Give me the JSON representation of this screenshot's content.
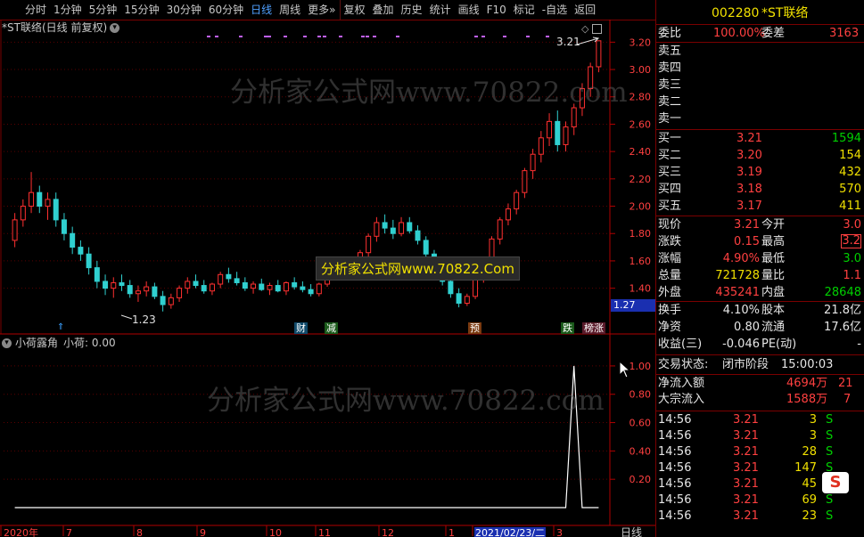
{
  "toolbar": {
    "items": [
      "分时",
      "1分钟",
      "5分钟",
      "15分钟",
      "30分钟",
      "60分钟",
      "日线",
      "周线",
      "更多»",
      "复权",
      "叠加",
      "历史",
      "统计",
      "画线",
      "F10",
      "标记",
      "-自选",
      "返回"
    ],
    "selected": "日线"
  },
  "kchart": {
    "title": "*ST联络(日线 前复权)",
    "high_label": "3.21",
    "low_label": "1.23",
    "current_price_tag": "1.27",
    "y_ticks": [
      "3.20",
      "3.00",
      "2.80",
      "2.60",
      "2.40",
      "2.20",
      "2.00",
      "1.80",
      "1.60",
      "1.40"
    ],
    "markers": [
      "财",
      "减",
      "预",
      "跌",
      "榜涨"
    ],
    "watermark": "分析家公式网www.70822.com",
    "banner": "分析家公式网www.70822.Com"
  },
  "indicator": {
    "name": "小荷露角",
    "value_label": "小荷: 0.00",
    "y_ticks": [
      "1.00",
      "0.80",
      "0.60",
      "0.40",
      "0.20"
    ],
    "watermark": "分析家公式网www.70822.com"
  },
  "timeaxis": {
    "labels": [
      "2020年",
      "7",
      "8",
      "9",
      "10",
      "11",
      "12",
      "1",
      "2021/02/23/二",
      "3"
    ],
    "period": "日线"
  },
  "chart_data": {
    "type": "candlestick",
    "ylim": [
      1.15,
      3.3
    ],
    "candles": [
      [
        1.75,
        1.95,
        1.7,
        1.9
      ],
      [
        1.9,
        2.05,
        1.85,
        2.0
      ],
      [
        2.0,
        2.25,
        1.95,
        2.1
      ],
      [
        2.1,
        2.15,
        1.95,
        2.0
      ],
      [
        2.0,
        2.1,
        1.9,
        2.05
      ],
      [
        2.05,
        2.1,
        1.85,
        1.9
      ],
      [
        1.9,
        1.95,
        1.75,
        1.8
      ],
      [
        1.8,
        1.85,
        1.65,
        1.7
      ],
      [
        1.7,
        1.75,
        1.6,
        1.65
      ],
      [
        1.65,
        1.7,
        1.5,
        1.55
      ],
      [
        1.55,
        1.6,
        1.4,
        1.45
      ],
      [
        1.45,
        1.5,
        1.35,
        1.4
      ],
      [
        1.4,
        1.48,
        1.33,
        1.44
      ],
      [
        1.44,
        1.5,
        1.38,
        1.42
      ],
      [
        1.42,
        1.46,
        1.33,
        1.36
      ],
      [
        1.36,
        1.42,
        1.3,
        1.38
      ],
      [
        1.38,
        1.45,
        1.34,
        1.41
      ],
      [
        1.41,
        1.44,
        1.32,
        1.34
      ],
      [
        1.34,
        1.38,
        1.23,
        1.28
      ],
      [
        1.28,
        1.36,
        1.25,
        1.33
      ],
      [
        1.33,
        1.42,
        1.3,
        1.4
      ],
      [
        1.4,
        1.48,
        1.36,
        1.45
      ],
      [
        1.45,
        1.5,
        1.4,
        1.42
      ],
      [
        1.42,
        1.46,
        1.36,
        1.38
      ],
      [
        1.38,
        1.44,
        1.35,
        1.43
      ],
      [
        1.43,
        1.52,
        1.4,
        1.5
      ],
      [
        1.5,
        1.55,
        1.44,
        1.47
      ],
      [
        1.47,
        1.52,
        1.42,
        1.44
      ],
      [
        1.44,
        1.48,
        1.38,
        1.4
      ],
      [
        1.4,
        1.45,
        1.36,
        1.43
      ],
      [
        1.43,
        1.47,
        1.38,
        1.39
      ],
      [
        1.39,
        1.44,
        1.35,
        1.42
      ],
      [
        1.42,
        1.46,
        1.37,
        1.38
      ],
      [
        1.38,
        1.45,
        1.35,
        1.44
      ],
      [
        1.44,
        1.48,
        1.39,
        1.41
      ],
      [
        1.41,
        1.45,
        1.37,
        1.39
      ],
      [
        1.39,
        1.43,
        1.34,
        1.36
      ],
      [
        1.36,
        1.44,
        1.34,
        1.43
      ],
      [
        1.43,
        1.52,
        1.41,
        1.5
      ],
      [
        1.5,
        1.56,
        1.46,
        1.53
      ],
      [
        1.53,
        1.6,
        1.5,
        1.57
      ],
      [
        1.57,
        1.62,
        1.52,
        1.55
      ],
      [
        1.55,
        1.68,
        1.53,
        1.66
      ],
      [
        1.66,
        1.8,
        1.62,
        1.78
      ],
      [
        1.78,
        1.92,
        1.74,
        1.88
      ],
      [
        1.88,
        1.94,
        1.8,
        1.84
      ],
      [
        1.84,
        1.9,
        1.76,
        1.8
      ],
      [
        1.8,
        1.92,
        1.78,
        1.88
      ],
      [
        1.88,
        1.92,
        1.8,
        1.82
      ],
      [
        1.82,
        1.86,
        1.72,
        1.75
      ],
      [
        1.75,
        1.78,
        1.62,
        1.65
      ],
      [
        1.65,
        1.68,
        1.52,
        1.55
      ],
      [
        1.55,
        1.58,
        1.42,
        1.45
      ],
      [
        1.45,
        1.48,
        1.33,
        1.36
      ],
      [
        1.36,
        1.4,
        1.26,
        1.29
      ],
      [
        1.29,
        1.36,
        1.27,
        1.34
      ],
      [
        1.34,
        1.48,
        1.32,
        1.46
      ],
      [
        1.46,
        1.62,
        1.44,
        1.6
      ],
      [
        1.6,
        1.78,
        1.58,
        1.76
      ],
      [
        1.76,
        1.92,
        1.72,
        1.9
      ],
      [
        1.9,
        2.02,
        1.86,
        1.98
      ],
      [
        1.98,
        2.12,
        1.94,
        2.1
      ],
      [
        2.1,
        2.28,
        2.06,
        2.26
      ],
      [
        2.26,
        2.42,
        2.2,
        2.38
      ],
      [
        2.38,
        2.55,
        2.32,
        2.5
      ],
      [
        2.5,
        2.68,
        2.44,
        2.62
      ],
      [
        2.62,
        2.7,
        2.4,
        2.45
      ],
      [
        2.45,
        2.62,
        2.4,
        2.58
      ],
      [
        2.58,
        2.75,
        2.52,
        2.72
      ],
      [
        2.72,
        2.9,
        2.66,
        2.86
      ],
      [
        2.86,
        3.05,
        2.8,
        3.02
      ],
      [
        3.02,
        3.21,
        2.98,
        3.21
      ]
    ],
    "indicator_values": [
      0,
      0,
      0,
      0,
      0,
      0,
      0,
      0,
      0,
      0,
      0,
      0,
      0,
      0,
      0,
      0,
      0,
      0,
      0,
      0,
      0,
      0,
      0,
      0,
      0,
      0,
      0,
      0,
      0,
      0,
      0,
      0,
      0,
      0,
      0,
      0,
      0,
      0,
      0,
      0,
      0,
      0,
      0,
      0,
      0,
      0,
      0,
      0,
      0,
      0,
      0,
      0,
      0,
      0,
      0,
      0,
      0,
      0,
      0,
      0,
      0,
      0,
      0,
      0,
      0,
      0,
      0,
      0,
      1.0,
      0,
      0,
      0
    ],
    "indicator_ylim": [
      0,
      1.1
    ]
  },
  "quote": {
    "code": "002280",
    "name": "*ST联络",
    "wei_bi_label": "委比",
    "wei_bi": "100.00%",
    "wei_cha_label": "委差",
    "wei_cha": "3163",
    "sells": [
      {
        "label": "卖五",
        "price": "",
        "vol": ""
      },
      {
        "label": "卖四",
        "price": "",
        "vol": ""
      },
      {
        "label": "卖三",
        "price": "",
        "vol": ""
      },
      {
        "label": "卖二",
        "price": "",
        "vol": ""
      },
      {
        "label": "卖一",
        "price": "",
        "vol": ""
      }
    ],
    "buys": [
      {
        "label": "买一",
        "price": "3.21",
        "vol": "1594"
      },
      {
        "label": "买二",
        "price": "3.20",
        "vol": "154"
      },
      {
        "label": "买三",
        "price": "3.19",
        "vol": "432"
      },
      {
        "label": "买四",
        "price": "3.18",
        "vol": "570"
      },
      {
        "label": "买五",
        "price": "3.17",
        "vol": "411"
      }
    ],
    "stats": [
      {
        "l1": "现价",
        "v1": "3.21",
        "l2": "今开",
        "v2": "3.0"
      },
      {
        "l1": "涨跌",
        "v1": "0.15",
        "l2": "最高",
        "v2": "3.2"
      },
      {
        "l1": "涨幅",
        "v1": "4.90%",
        "l2": "最低",
        "v2": "3.0"
      },
      {
        "l1": "总量",
        "v1": "721728",
        "l2": "量比",
        "v2": "1.1"
      },
      {
        "l1": "外盘",
        "v1": "435241",
        "l2": "内盘",
        "v2": "28648"
      }
    ],
    "stats2": [
      {
        "l1": "换手",
        "v1": "4.10%",
        "l2": "股本",
        "v2": "21.8亿"
      },
      {
        "l1": "净资",
        "v1": "0.80",
        "l2": "流通",
        "v2": "17.6亿"
      },
      {
        "l1": "收益(三)",
        "v1": "-0.046",
        "l2": "PE(动)",
        "v2": "-"
      }
    ],
    "trade_status_label": "交易状态:",
    "trade_status": "闭市阶段",
    "trade_time": "15:00:03",
    "net_inflow_label": "净流入额",
    "net_inflow": "4694万",
    "net_inflow_tail": "21",
    "block_inflow_label": "大宗流入",
    "block_inflow": "1588万",
    "block_inflow_tail": "7",
    "ticks": [
      {
        "t": "14:56",
        "p": "3.21",
        "v": "3",
        "s": "S"
      },
      {
        "t": "14:56",
        "p": "3.21",
        "v": "3",
        "s": "S"
      },
      {
        "t": "14:56",
        "p": "3.21",
        "v": "28",
        "s": "S"
      },
      {
        "t": "14:56",
        "p": "3.21",
        "v": "147",
        "s": "S"
      },
      {
        "t": "14:56",
        "p": "3.21",
        "v": "45",
        "s": "S"
      },
      {
        "t": "14:56",
        "p": "3.21",
        "v": "69",
        "s": "S"
      },
      {
        "t": "14:56",
        "p": "3.21",
        "v": "23",
        "s": "S"
      }
    ]
  }
}
